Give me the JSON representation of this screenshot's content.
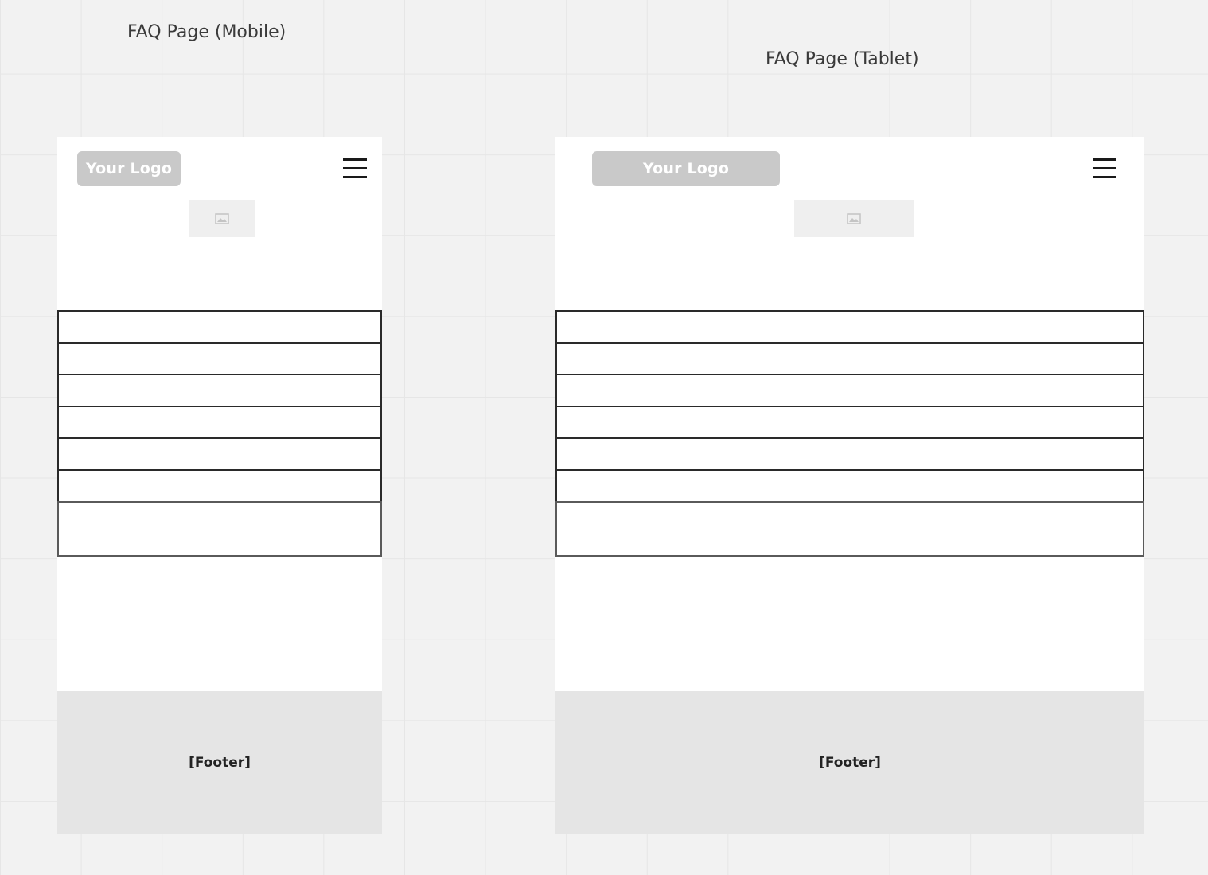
{
  "frames": {
    "mobile": {
      "title": "FAQ Page (Mobile)",
      "logo": "Your Logo",
      "menu_icon": "hamburger-menu-icon",
      "image_icon": "image-icon",
      "footer": "[Footer]"
    },
    "tablet": {
      "title": "FAQ Page (Tablet)",
      "logo": "Your Logo",
      "menu_icon": "hamburger-menu-icon",
      "image_icon": "image-icon",
      "footer": "[Footer]"
    }
  },
  "faq_row_count": 7,
  "colors": {
    "canvas": "#f2f2f2",
    "frame": "#ffffff",
    "logo_bg": "#c9c9c9",
    "footer_bg": "#e5e5e5",
    "row_border": "#2a2a2a"
  }
}
